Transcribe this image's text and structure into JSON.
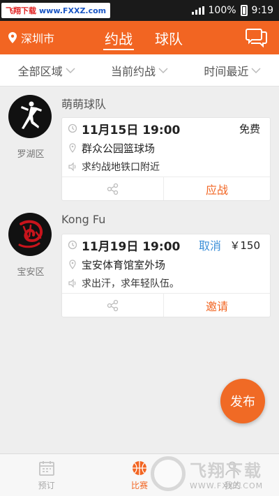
{
  "status_bar": {
    "watermark_cn": "飞翔下载",
    "watermark_url": "www.FXXZ.com",
    "battery": "100%",
    "time": "9:19"
  },
  "header": {
    "location": "深圳市",
    "tabs": [
      {
        "label": "约战",
        "active": true
      },
      {
        "label": "球队",
        "active": false
      }
    ],
    "accent_color": "#f26522"
  },
  "filters": [
    "全部区域",
    "当前约战",
    "时间最近"
  ],
  "matches": [
    {
      "team": "萌萌球队",
      "district": "罗湖区",
      "datetime": "11月15日 19:00",
      "price": "免费",
      "cancel": "",
      "venue": "群众公园篮球场",
      "note": "求约战地铁口附近",
      "action": "应战",
      "avatar_icon": "jumpman-logo-icon"
    },
    {
      "team": "Kong Fu",
      "district": "宝安区",
      "datetime": "11月19日 19:00",
      "price": "￥150",
      "cancel": "取消",
      "venue": "宝安体育馆室外场",
      "note": "求出汗，求年轻队伍。",
      "action": "邀请",
      "avatar_icon": "red-dragon-logo-icon"
    }
  ],
  "fab": "发布",
  "bottom_nav": [
    {
      "label": "预订",
      "icon": "calendar-icon",
      "active": false
    },
    {
      "label": "比赛",
      "icon": "basketball-icon",
      "active": true
    },
    {
      "label": "我的",
      "icon": "profile-icon",
      "active": false
    }
  ],
  "bottom_watermark": {
    "cn": "飞翔下载",
    "url": "WWW.FXXZ.COM"
  }
}
